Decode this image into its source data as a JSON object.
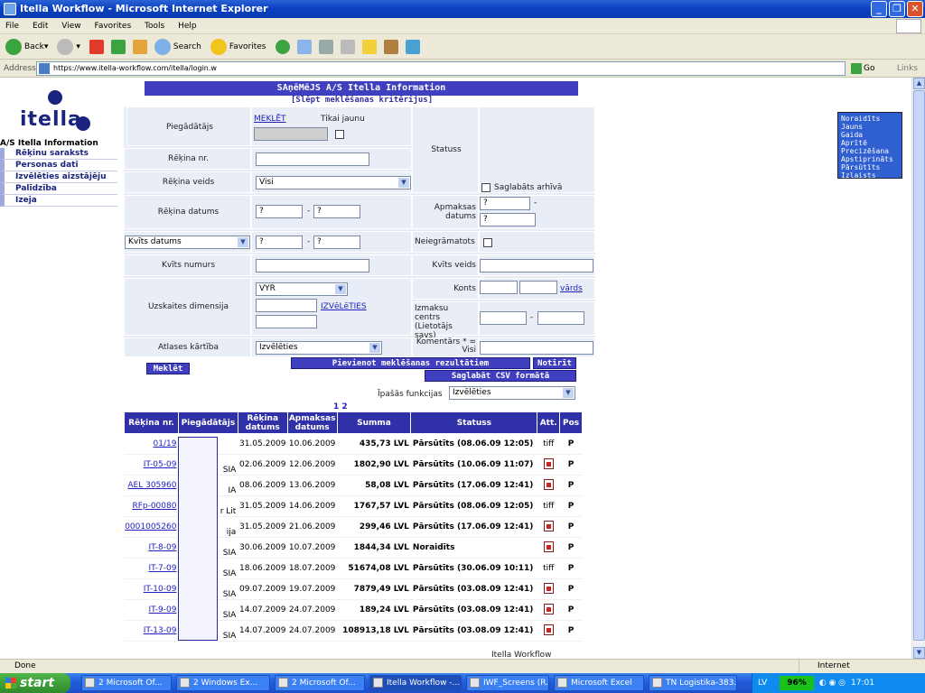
{
  "window": {
    "title": "Itella Workflow - Microsoft Internet Explorer"
  },
  "menu": [
    "File",
    "Edit",
    "View",
    "Favorites",
    "Tools",
    "Help"
  ],
  "toolbar": {
    "back": "Back",
    "search": "Search",
    "favorites": "Favorites"
  },
  "address": {
    "label": "Address",
    "url": "https://www.itella-workflow.com/itella/login.w",
    "go": "Go",
    "links": "Links"
  },
  "nav": {
    "logo": "itella",
    "org": "A/S Itella Information",
    "items": [
      "Rēķinu saraksts",
      "Personas dati",
      "Izvēlēties aizstājēju",
      "Palīdzība",
      "Izeja"
    ]
  },
  "page": {
    "header": "SAņēMēJS A/S Itella Information",
    "hide": "[Slēpt meklēšanas kritērijus]"
  },
  "form": {
    "supplier_label": "Piegādātājs",
    "search_link": "MEKLĒT",
    "only_new": "Tikai jaunu",
    "invoice_no": "Rēķina nr.",
    "invoice_type": "Rēķina veids",
    "invoice_type_val": "Visi",
    "invoice_date": "Rēķina datums",
    "date_ph1": "?",
    "date_ph2": "?",
    "receipt_date_sel": "Kvīts datums",
    "receipt_no": "Kvīts numurs",
    "dimension": "Uzskaites dimensija",
    "dimension_val": "VYR",
    "choose_link": "IZVēLēTIES",
    "order": "Atlases kārtība",
    "order_val": "Izvēlēties",
    "status_label": "Statuss",
    "statuses": [
      "Noraidīts",
      "Jauns",
      "Gaida",
      "Aprītē",
      "Precizēšana",
      "Apstiprināts",
      "Pārsūtīts",
      "Izlaists"
    ],
    "archive": "Saglabāts arhīvā",
    "pay_date": "Apmaksas datums",
    "not_booked": "Neiegrāmatots",
    "receipt_type": "Kvīts veids",
    "account": "Konts",
    "name_link": "vārds",
    "cost_center": "Izmaksu centrs (Lietotājs savs)",
    "comment": "Komentārs * = Visi",
    "search_btn": "Meklēt",
    "append_btn": "Pievienot meklēšanas rezultātiem",
    "clear_btn": "Notīrīt",
    "csv_btn": "Saglabāt CSV formātā",
    "special": "Īpašās funkcijas",
    "special_val": "Izvēlēties",
    "pages": "1 2"
  },
  "table": {
    "headers": [
      "Rēķina nr.",
      "Piegādātājs",
      "Rēķina datums",
      "Apmaksas datums",
      "Summa",
      "Statuss",
      "Att.",
      "Pos"
    ],
    "rows": [
      {
        "no": "01/19",
        "sup": "",
        "d1": "31.05.2009",
        "d2": "10.06.2009",
        "sum": "435,73 LVL",
        "st": "Pārsūtīts (08.06.09 12:05)",
        "att": "tiff",
        "pos": "P"
      },
      {
        "no": "IT-05-09",
        "sup": "SIA",
        "d1": "02.06.2009",
        "d2": "12.06.2009",
        "sum": "1802,90 LVL",
        "st": "Pārsūtīts (10.06.09 11:07)",
        "att": "pdf",
        "pos": "P"
      },
      {
        "no": "AEL 305960",
        "sup": "IA",
        "d1": "08.06.2009",
        "d2": "13.06.2009",
        "sum": "58,08 LVL",
        "st": "Pārsūtīts (17.06.09 12:41)",
        "att": "pdf",
        "pos": "P"
      },
      {
        "no": "RFp-00080",
        "sup": "r Lit",
        "d1": "31.05.2009",
        "d2": "14.06.2009",
        "sum": "1767,57 LVL",
        "st": "Pārsūtīts (08.06.09 12:05)",
        "att": "tiff",
        "pos": "P"
      },
      {
        "no": "0001005260",
        "sup": "ija",
        "d1": "31.05.2009",
        "d2": "21.06.2009",
        "sum": "299,46 LVL",
        "st": "Pārsūtīts (17.06.09 12:41)",
        "att": "pdf",
        "pos": "P"
      },
      {
        "no": "IT-8-09",
        "sup": "SIA",
        "d1": "30.06.2009",
        "d2": "10.07.2009",
        "sum": "1844,34 LVL",
        "st": "Noraidīts",
        "att": "pdf",
        "pos": "P"
      },
      {
        "no": "IT-7-09",
        "sup": "SIA",
        "d1": "18.06.2009",
        "d2": "18.07.2009",
        "sum": "51674,08 LVL",
        "st": "Pārsūtīts (30.06.09 10:11)",
        "att": "tiff",
        "pos": "P"
      },
      {
        "no": "IT-10-09",
        "sup": "SIA",
        "d1": "09.07.2009",
        "d2": "19.07.2009",
        "sum": "7879,49 LVL",
        "st": "Pārsūtīts (03.08.09 12:41)",
        "att": "pdf",
        "pos": "P"
      },
      {
        "no": "IT-9-09",
        "sup": "SIA",
        "d1": "14.07.2009",
        "d2": "24.07.2009",
        "sum": "189,24 LVL",
        "st": "Pārsūtīts (03.08.09 12:41)",
        "att": "pdf",
        "pos": "P"
      },
      {
        "no": "IT-13-09",
        "sup": "SIA",
        "d1": "14.07.2009",
        "d2": "24.07.2009",
        "sum": "108913,18 LVL",
        "st": "Pārsūtīts (03.08.09 12:41)",
        "att": "pdf",
        "pos": "P"
      }
    ],
    "footer": "Itella Workflow"
  },
  "status": {
    "text": "Done",
    "zone": "Internet"
  },
  "taskbar": {
    "start": "start",
    "tasks": [
      "2 Microsoft Of...",
      "2 Windows Ex...",
      "2 Microsoft Of...",
      "Itella Workflow -...",
      "IWF_Screens (R...",
      "Microsoft Excel",
      "TN Logistika-383..."
    ],
    "lang": "LV",
    "pct": "96%",
    "clock": "17:01"
  },
  "colors": {
    "header_bg": "#3f3fbf",
    "rejected_pos": "#cc0000"
  }
}
